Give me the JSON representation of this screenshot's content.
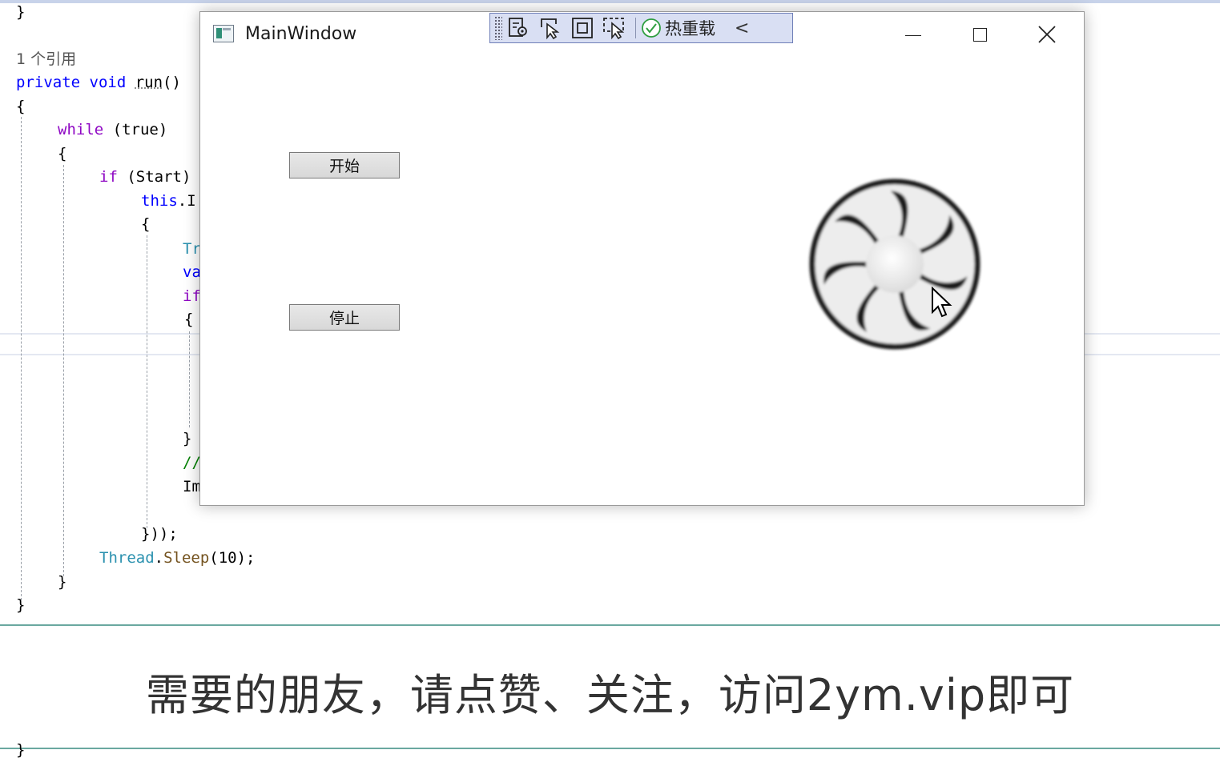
{
  "editor": {
    "reference_count": "1 个引用",
    "lines": {
      "close_brace_top": "}",
      "signature_kw": "private void ",
      "signature_name": "run",
      "signature_tail": "()",
      "open_brace": "{",
      "while_kw": "while",
      "while_tail": " (true)",
      "while_open": "{",
      "if_kw": "if",
      "if_tail": " (Start)",
      "this_kw": "this",
      "this_tail": ".I",
      "inner_open": "{",
      "tr_frag": "Tr",
      "va_frag": "va",
      "if_frag": "if",
      "block_open": "{",
      "block_close": "}",
      "comment_frag": "//",
      "im_frag": "Im",
      "lambda_close": "}));",
      "sleep_type": "Thread",
      "sleep_dot": ".",
      "sleep_method": "Sleep",
      "sleep_args": "(10);",
      "while_close": "}",
      "method_close": "}",
      "bottom_brace": "}"
    }
  },
  "window": {
    "title": "MainWindow",
    "start_button": "开始",
    "stop_button": "停止",
    "minimize_icon": "minimize-icon",
    "maximize_icon": "maximize-icon",
    "close_icon": "close-icon"
  },
  "debug_toolbar": {
    "hot_reload_label": "热重载",
    "collapse_glyph": "<"
  },
  "subtitle": "需要的朋友，请点赞、关注，访问2ym.vip即可",
  "colors": {
    "keyword": "#0000ff",
    "control_keyword": "#8f08c4",
    "type": "#2b91af",
    "method": "#74531f",
    "toolbar_bg": "#d9dff3",
    "subtitle_rule": "#6aa8a0"
  }
}
